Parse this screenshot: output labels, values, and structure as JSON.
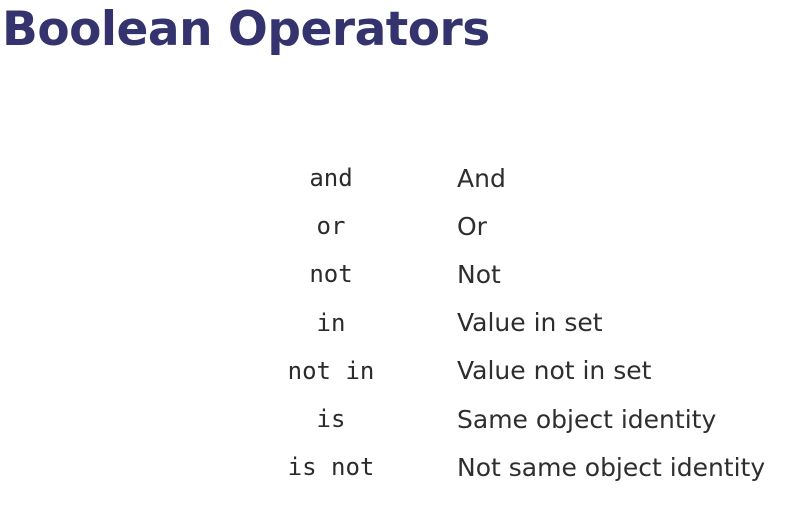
{
  "slide": {
    "title": "Boolean Operators",
    "operators": [
      {
        "code": "and",
        "description": "And"
      },
      {
        "code": "or",
        "description": "Or"
      },
      {
        "code": "not",
        "description": "Not"
      },
      {
        "code": "in",
        "description": "Value in set"
      },
      {
        "code": "not in",
        "description": "Value not in set"
      },
      {
        "code": "is",
        "description": "Same object identity"
      },
      {
        "code": "is not",
        "description": "Not same object identity"
      }
    ]
  },
  "colors": {
    "title": "#34336e",
    "text": "#2e2e2e",
    "background": "#ffffff"
  }
}
